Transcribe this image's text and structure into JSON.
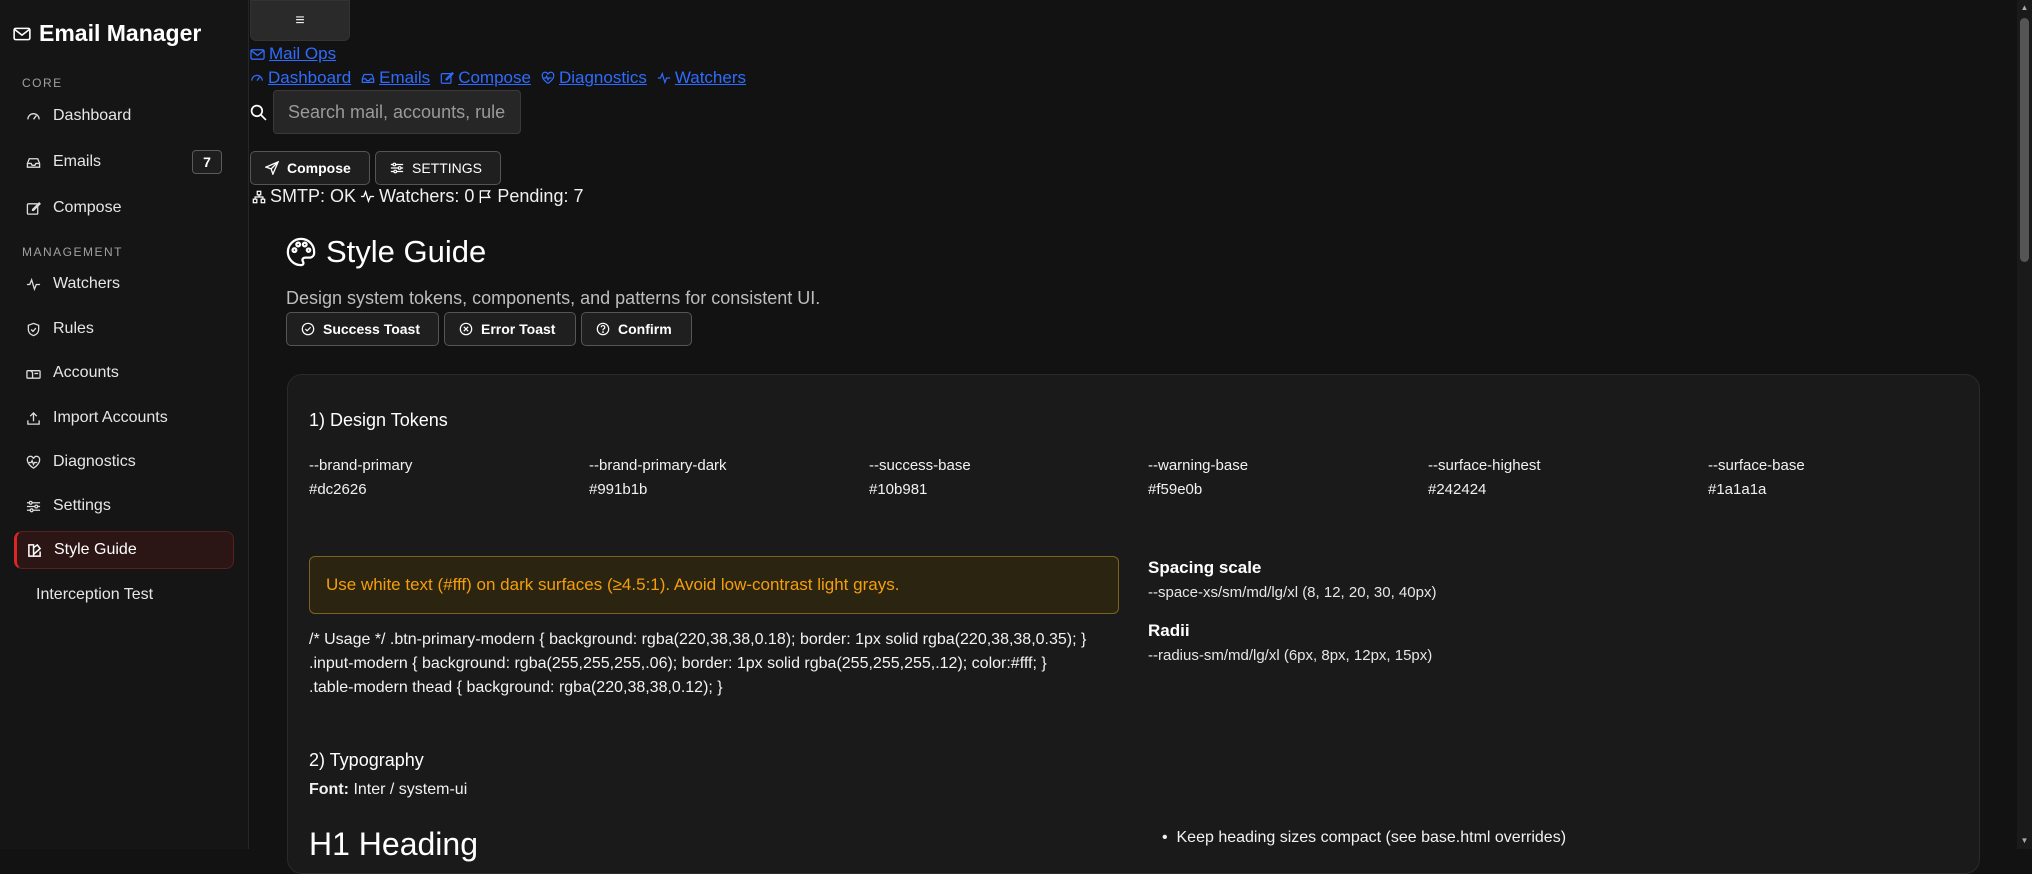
{
  "app": {
    "title": "Email Manager"
  },
  "sidebar": {
    "sections": {
      "core": "CORE",
      "management": "MANAGEMENT"
    },
    "items": [
      {
        "label": "Dashboard",
        "icon": "gauge-icon"
      },
      {
        "label": "Emails",
        "icon": "inbox-icon",
        "badge": "7"
      },
      {
        "label": "Compose",
        "icon": "pencil-square-icon"
      },
      {
        "label": "Watchers",
        "icon": "activity-icon"
      },
      {
        "label": "Rules",
        "icon": "shield-icon"
      },
      {
        "label": "Accounts",
        "icon": "mailbox-icon"
      },
      {
        "label": "Import Accounts",
        "icon": "upload-icon"
      },
      {
        "label": "Diagnostics",
        "icon": "heart-pulse-icon"
      },
      {
        "label": "Settings",
        "icon": "sliders-icon"
      },
      {
        "label": "Style Guide",
        "icon": "palette-icon",
        "active": true
      },
      {
        "label": "Interception Test"
      }
    ]
  },
  "topbar": {
    "menu_glyph": "≡",
    "brand_link": "Mail Ops",
    "nav_links": [
      "Dashboard",
      "Emails",
      "Compose",
      "Diagnostics",
      "Watchers"
    ],
    "search_placeholder": "Search mail, accounts, rules",
    "compose_label": "Compose",
    "settings_label": "SETTINGS",
    "status": {
      "smtp": "SMTP: OK",
      "watchers": "Watchers: 0",
      "pending": "Pending: 7"
    }
  },
  "page": {
    "title": "Style Guide",
    "subtitle": "Design system tokens, components, and patterns for consistent UI.",
    "actions": [
      "Success Toast",
      "Error Toast",
      "Confirm"
    ]
  },
  "tokens": {
    "heading": "1) Design Tokens",
    "items": [
      {
        "name": "--brand-primary",
        "value": "#dc2626"
      },
      {
        "name": "--brand-primary-dark",
        "value": "#991b1b"
      },
      {
        "name": "--success-base",
        "value": "#10b981"
      },
      {
        "name": "--warning-base",
        "value": "#f59e0b"
      },
      {
        "name": "--surface-highest",
        "value": "#242424"
      },
      {
        "name": "--surface-base",
        "value": "#1a1a1a"
      }
    ],
    "warning": "Use white text (#fff) on dark surfaces (≥4.5:1). Avoid low-contrast light grays.",
    "usage_code": "/* Usage */ .btn-primary-modern { background: rgba(220,38,38,0.18); border: 1px solid rgba(220,38,38,0.35); } .input-modern { background: rgba(255,255,255,.06); border: 1px solid rgba(255,255,255,.12); color:#fff; } .table-modern thead { background: rgba(220,38,38,0.12); }",
    "spacing_heading": "Spacing scale",
    "spacing_text": "--space-xs/sm/md/lg/xl (8, 12, 20, 30, 40px)",
    "radii_heading": "Radii",
    "radii_text": "--radius-sm/md/lg/xl (6px, 8px, 12px, 15px)"
  },
  "typography": {
    "heading": "2) Typography",
    "font_label": "Font:",
    "font_value": "Inter / system-ui",
    "h1_demo": "H1 Heading",
    "bullet": "Keep heading sizes compact (see base.html overrides)"
  },
  "colors": {
    "accent": "#dc2626",
    "link": "#2f6bff",
    "warning": "#f59e0b"
  }
}
